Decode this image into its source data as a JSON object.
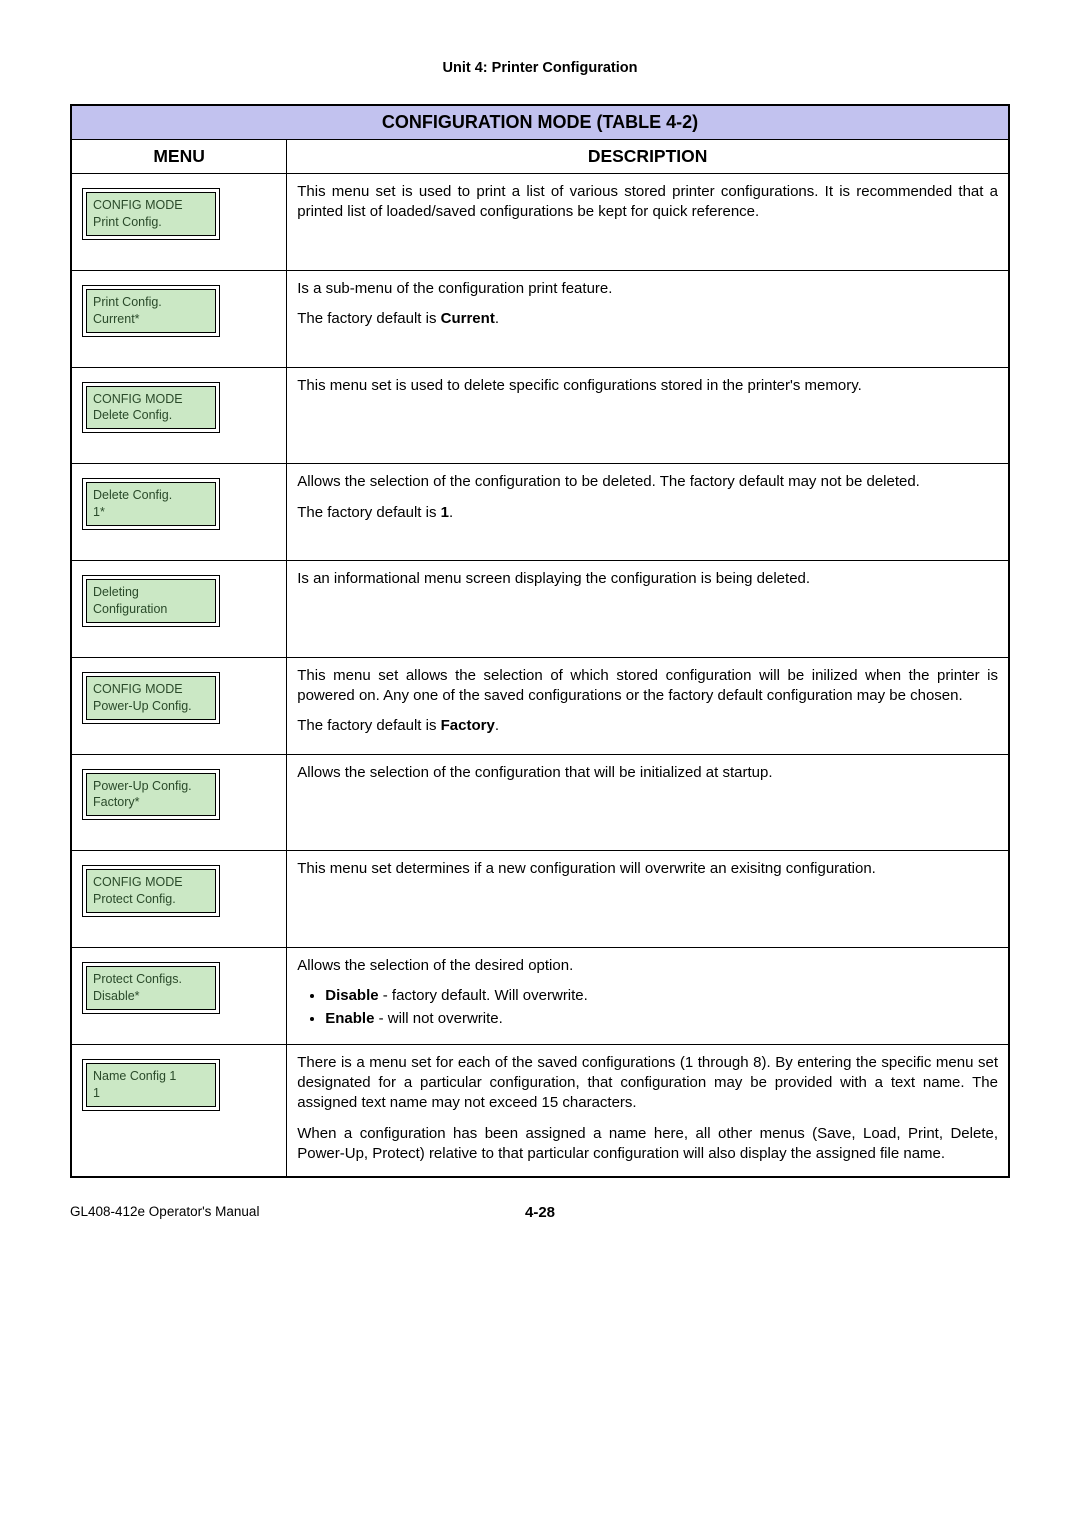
{
  "unit_header": "Unit 4:  Printer Configuration",
  "table_title": "CONFIGURATION MODE (TABLE 4-2)",
  "col_menu": "MENU",
  "col_desc": "DESCRIPTION",
  "rows": [
    {
      "menu_line1": "CONFIG MODE",
      "menu_line2": "Print Config.",
      "desc_html": "This menu set is used to print a list of various stored printer configurations. It is recommended that a printed list of loaded/saved configurations be kept for quick reference."
    },
    {
      "menu_line1": "Print Config.",
      "menu_line2": "Current*",
      "desc_p1": "Is a sub-menu of the configuration print feature.",
      "desc_p2_pre": "The factory default is ",
      "desc_p2_bold": "Current",
      "desc_p2_post": "."
    },
    {
      "menu_line1": "CONFIG MODE",
      "menu_line2": "Delete Config.",
      "desc_html": "This menu set is used to delete specific configurations stored in the printer's memory."
    },
    {
      "menu_line1": "Delete Config.",
      "menu_line2": "1*",
      "desc_p1": "Allows the selection of the configuration to be deleted. The factory default may not be deleted.",
      "desc_p2_pre": "The factory default is ",
      "desc_p2_bold": "1",
      "desc_p2_post": "."
    },
    {
      "menu_line1": "Deleting",
      "menu_line2": "Configuration",
      "desc_html": "Is an informational menu screen displaying the configuration is being deleted."
    },
    {
      "menu_line1": "CONFIG MODE",
      "menu_line2": "Power-Up Config.",
      "desc_p1": "This menu set allows the selection of which stored configuration will be inilized when the printer is powered on. Any one of the saved configurations or the factory default configuration may be chosen.",
      "desc_p2_pre": "The factory default is ",
      "desc_p2_bold": "Factory",
      "desc_p2_post": "."
    },
    {
      "menu_line1": "Power-Up Config.",
      "menu_line2": "Factory*",
      "desc_html": "Allows the selection of the configuration that will be initialized at startup."
    },
    {
      "menu_line1": "CONFIG MODE",
      "menu_line2": "Protect Config.",
      "desc_html": "This menu set determines if a new configuration will overwrite an exisitng configuration."
    },
    {
      "menu_line1": "Protect Configs.",
      "menu_line2": "Disable*",
      "desc_p1": "Allows the selection of the desired option.",
      "bullet1_bold": "Disable",
      "bullet1_rest": " - factory default. Will overwrite.",
      "bullet2_bold": "Enable",
      "bullet2_rest": " -  will not overwrite."
    },
    {
      "menu_line1": "Name Config 1",
      "menu_line2": "1",
      "desc_p1": "There is a menu set for each of the saved configurations (1 through 8). By entering the specific menu set designated for a particular configuration, that configuration may be provided with a text name. The assigned text name may not exceed 15 characters.",
      "desc_p2": "When a configuration has been assigned a name here, all other menus (Save, Load, Print, Delete, Power-Up, Protect) relative to that particular configuration will also display the assigned file name."
    }
  ],
  "footer_left": "GL408-412e Operator's Manual",
  "footer_center": "4-28"
}
